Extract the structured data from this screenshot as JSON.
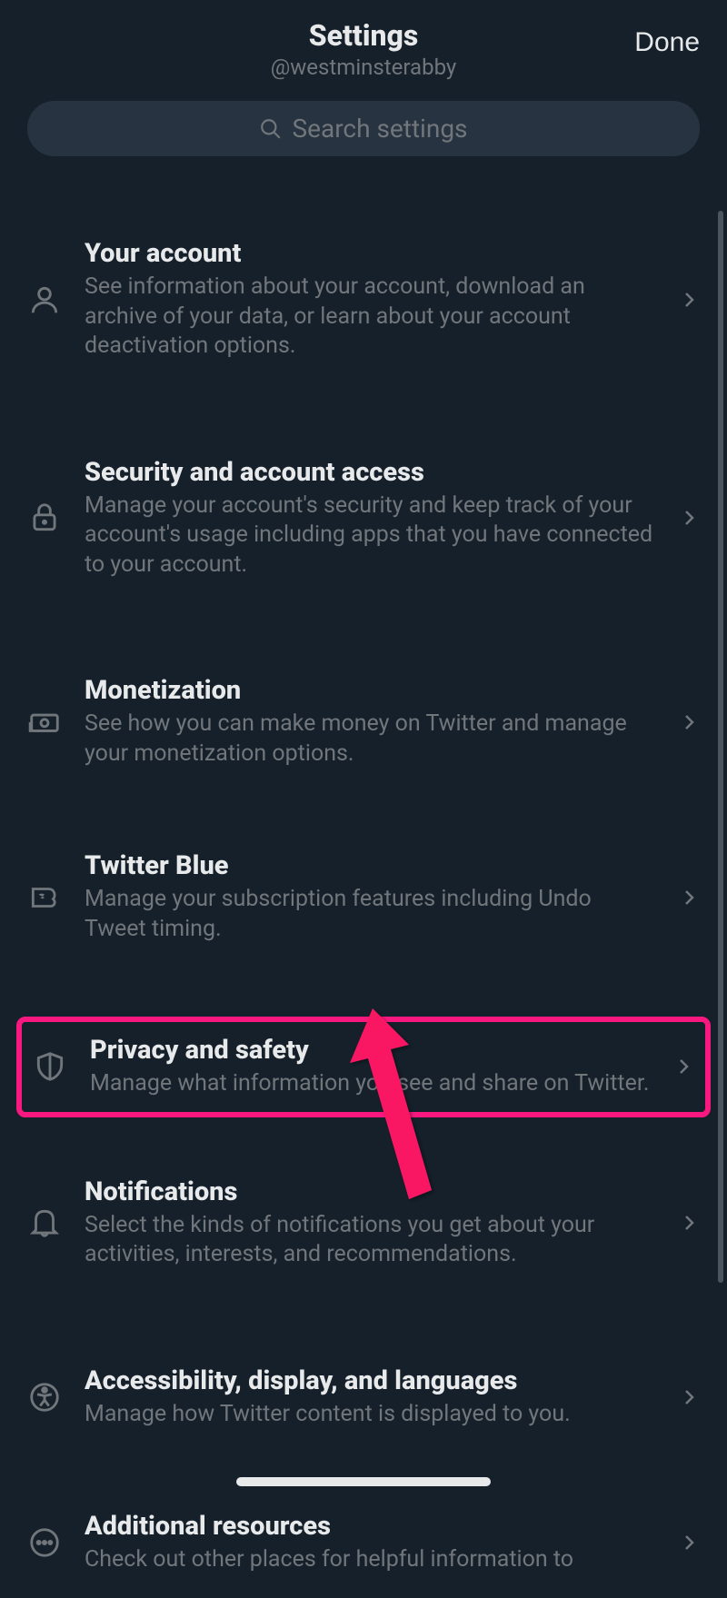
{
  "header": {
    "title": "Settings",
    "subtitle": "@westminsterabby",
    "done_label": "Done"
  },
  "search": {
    "placeholder": "Search settings"
  },
  "items": [
    {
      "icon": "person",
      "title": "Your account",
      "description": "See information about your account, download an archive of your data, or learn about your account deactivation options."
    },
    {
      "icon": "lock",
      "title": "Security and account access",
      "description": "Manage your account's security and keep track of your account's usage including apps that you have connected to your account."
    },
    {
      "icon": "money",
      "title": "Monetization",
      "description": "See how you can make money on Twitter and manage your monetization options."
    },
    {
      "icon": "twitter-blue",
      "title": "Twitter Blue",
      "description": "Manage your subscription features including Undo Tweet timing."
    },
    {
      "icon": "shield",
      "title": "Privacy and safety",
      "description": "Manage what information you see and share on Twitter."
    },
    {
      "icon": "bell",
      "title": "Notifications",
      "description": "Select the kinds of notifications you get about your activities, interests, and recommendations."
    },
    {
      "icon": "accessibility",
      "title": "Accessibility, display, and languages",
      "description": "Manage how Twitter content is displayed to you."
    },
    {
      "icon": "more",
      "title": "Additional resources",
      "description": "Check out other places for helpful information to"
    }
  ]
}
